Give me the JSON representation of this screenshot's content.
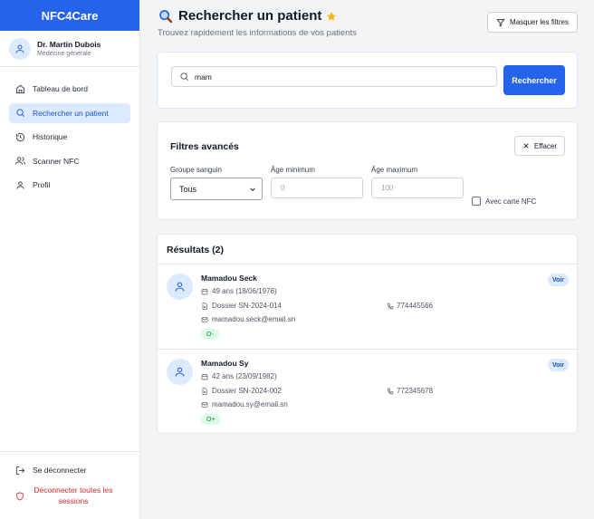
{
  "app": {
    "brand": "NFC4Care"
  },
  "user": {
    "name": "Dr. Martin Dubois",
    "role": "Médecine générale"
  },
  "nav": [
    {
      "label": "Tableau de bord",
      "icon": "home-icon"
    },
    {
      "label": "Rechercher un patient",
      "icon": "search-icon",
      "active": true
    },
    {
      "label": "Historique",
      "icon": "history-icon"
    },
    {
      "label": "Scanner NFC",
      "icon": "users-icon"
    },
    {
      "label": "Profil",
      "icon": "user-icon"
    }
  ],
  "sidebar_bottom": {
    "logout": "Se déconnecter",
    "logout_all": "Déconnecter toutes les sessions"
  },
  "header": {
    "title": "Rechercher un patient",
    "subtitle": "Trouvez rapidement les informations de vos patients",
    "toggle_filters": "Masquer les filtres"
  },
  "search": {
    "value": "mam",
    "button": "Rechercher"
  },
  "filters": {
    "title": "Filtres avancés",
    "clear": "Effacer",
    "blood_group_label": "Groupe sanguin",
    "blood_group_value": "Tous",
    "age_min_label": "Âge minimum",
    "age_min_placeholder": "0",
    "age_max_label": "Âge maximum",
    "age_max_placeholder": "100",
    "nfc_label": "Avec carte NFC"
  },
  "results": {
    "title": "Résultats (2)",
    "patients": [
      {
        "name": "Mamadou Seck",
        "age": "49 ans (18/06/1976)",
        "file": "Dossier SN-2024-014",
        "phone": "774445566",
        "email": "mamadou.seck@email.sn",
        "blood": "O-",
        "action": "Voir"
      },
      {
        "name": "Mamadou Sy",
        "age": "42 ans (23/09/1982)",
        "file": "Dossier SN-2024-002",
        "phone": "772345678",
        "email": "mamadou.sy@email.sn",
        "blood": "O+",
        "action": "Voir"
      }
    ]
  },
  "colors": {
    "primary": "#2563eb",
    "active_bg": "#dbeafe",
    "danger": "#dc2626",
    "badge_green_bg": "#dcfce7",
    "badge_green_text": "#15803d"
  }
}
